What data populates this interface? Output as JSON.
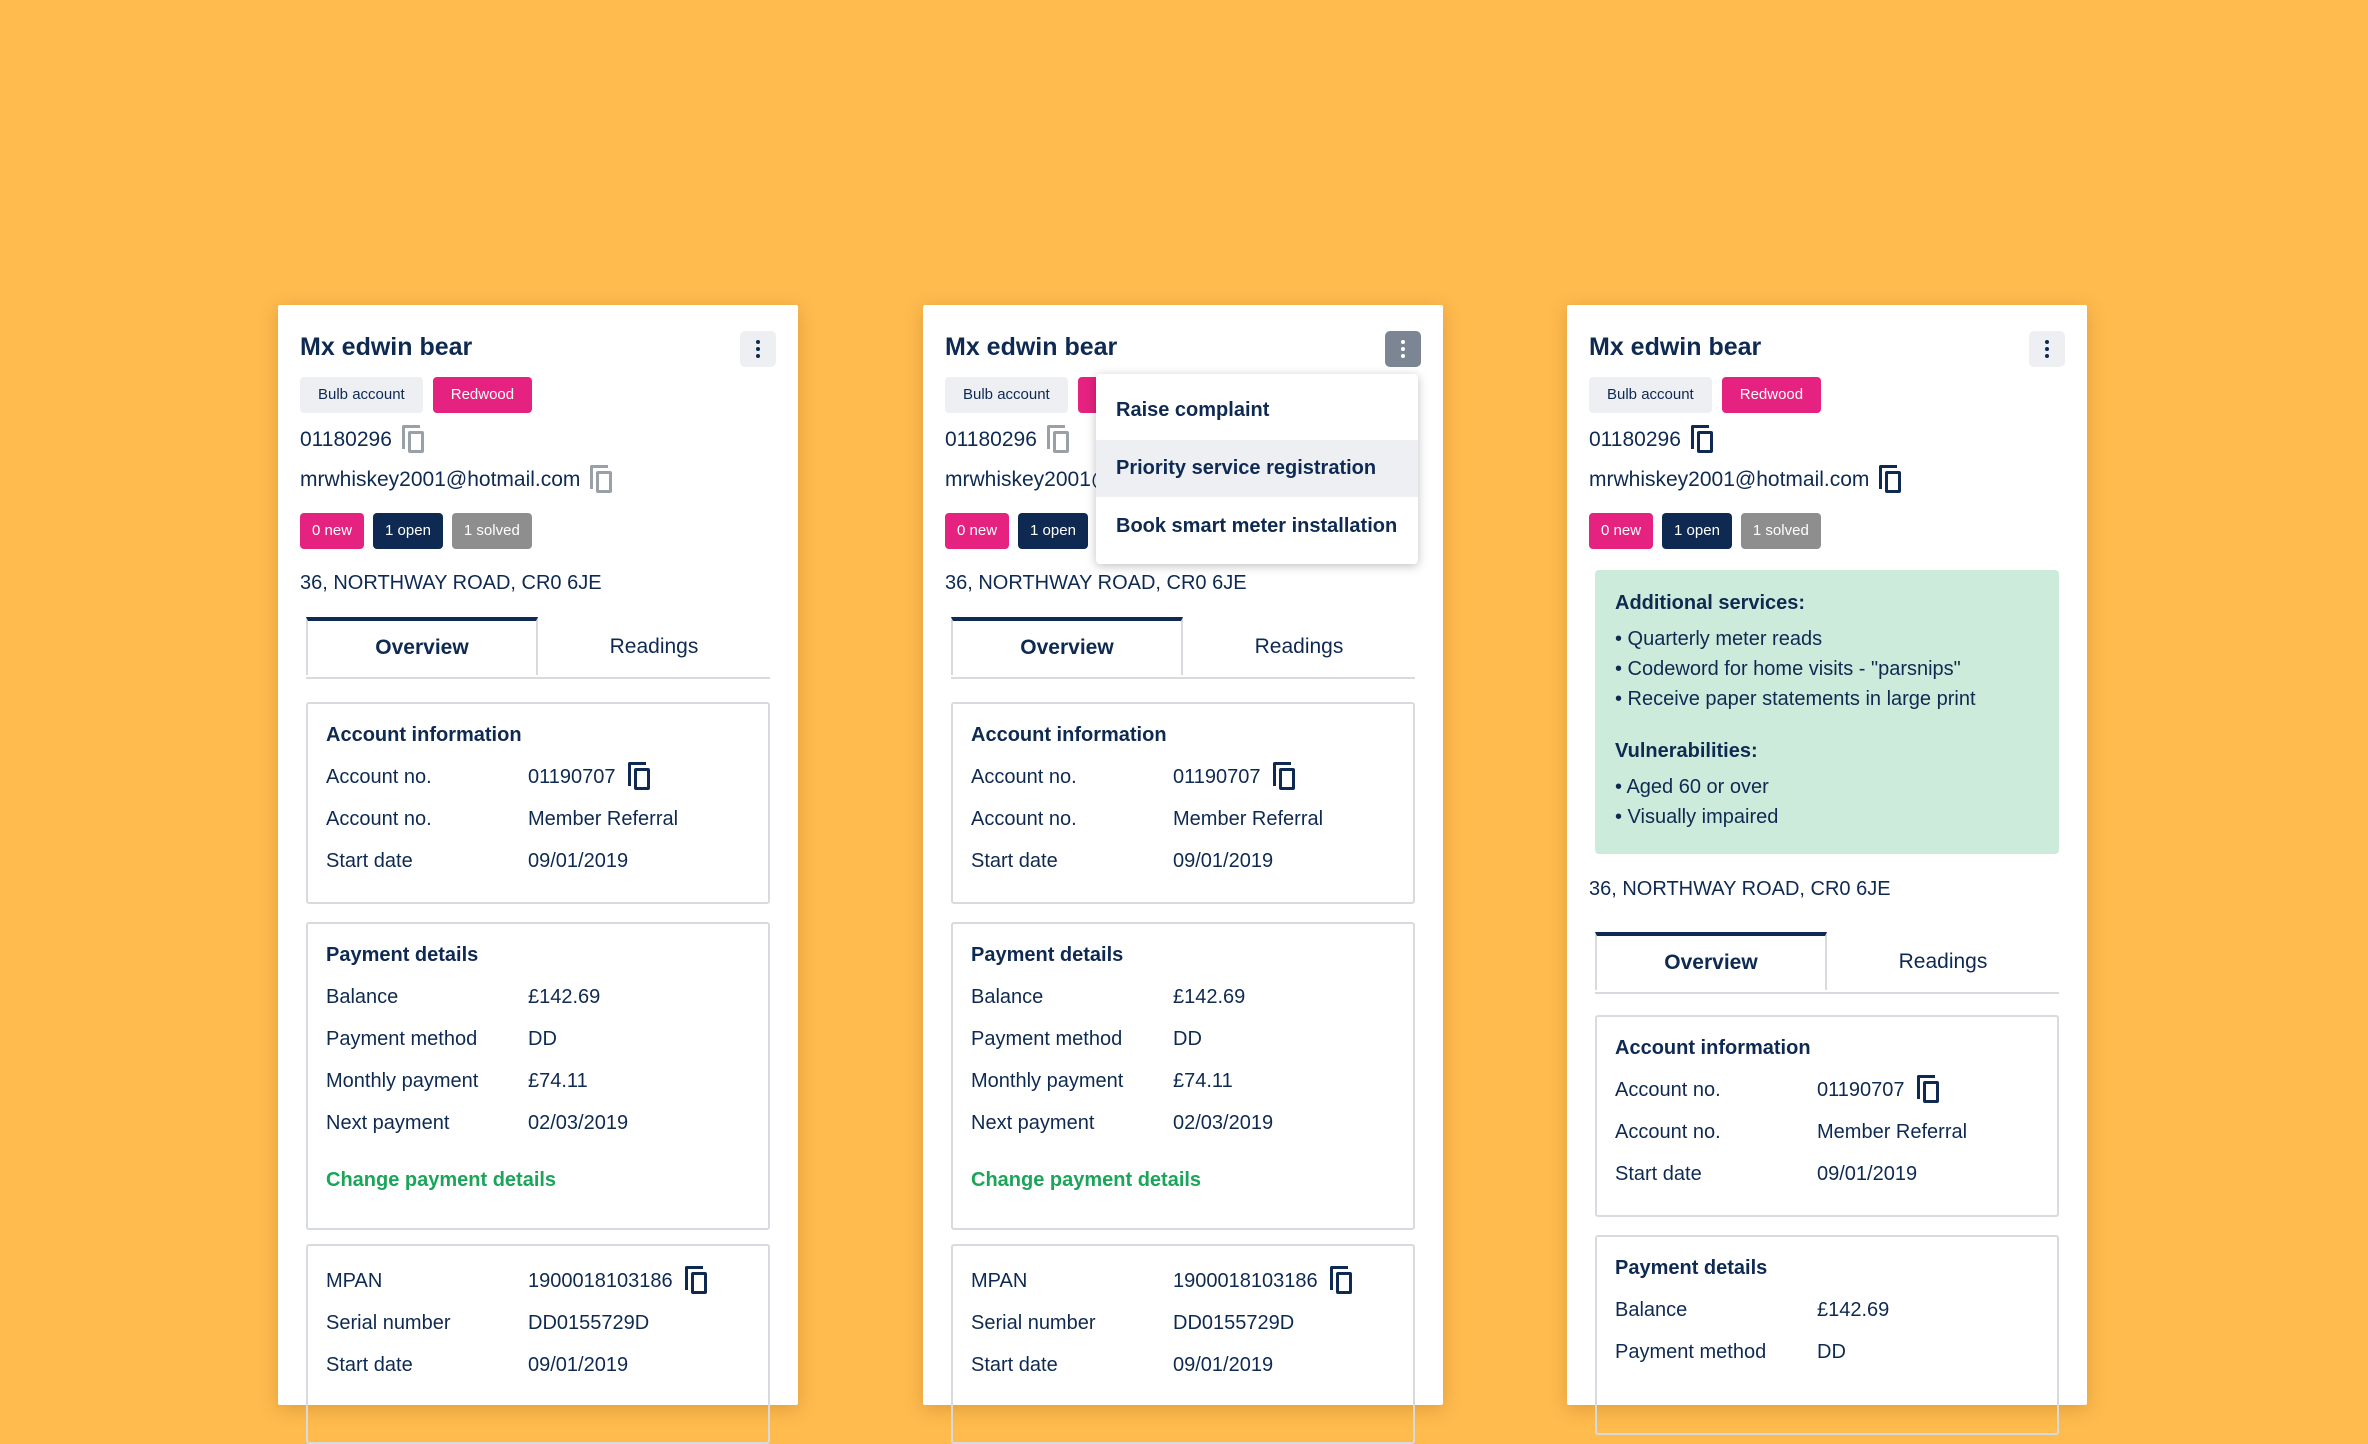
{
  "customer": {
    "name": "Mx edwin bear",
    "account_tag": "Bulb account",
    "tariff_tag": "Redwood",
    "phone": "01180296",
    "email": "mrwhiskey2001@hotmail.com",
    "counts": {
      "new": "0 new",
      "open": "1 open",
      "solved": "1 solved"
    },
    "address": "36, NORTHWAY ROAD, CR0 6JE"
  },
  "tabs": {
    "overview": "Overview",
    "readings": "Readings"
  },
  "account_info": {
    "title": "Account information",
    "rows": [
      {
        "label": "Account no.",
        "value": "01190707"
      },
      {
        "label": "Account no.",
        "value": "Member Referral"
      },
      {
        "label": "Start date",
        "value": "09/01/2019"
      }
    ]
  },
  "payment": {
    "title": "Payment details",
    "rows": [
      {
        "label": "Balance",
        "value": "£142.69"
      },
      {
        "label": "Payment method",
        "value": "DD"
      },
      {
        "label": "Monthly payment",
        "value": "£74.11"
      },
      {
        "label": "Next payment",
        "value": "02/03/2019"
      }
    ],
    "change_link": "Change payment details"
  },
  "meter": {
    "rows": [
      {
        "label": "MPAN",
        "value": "1900018103186"
      },
      {
        "label": "Serial number",
        "value": "DD0155729D"
      },
      {
        "label": "Start date",
        "value": "09/01/2019"
      }
    ]
  },
  "menu": {
    "items": [
      "Raise complaint",
      "Priority service registration",
      "Book smart meter installation"
    ]
  },
  "additional": {
    "services_title": "Additional services:",
    "services": [
      "• Quarterly meter reads",
      "• Codeword for home visits - \"parsnips\"",
      "• Receive paper statements in large print"
    ],
    "vuln_title": "Vulnerabilities:",
    "vulnerabilities": [
      "• Aged 60 or over",
      "• Visually impaired"
    ]
  },
  "colors": {
    "background": "#FFBB4E",
    "navy": "#0E2A52",
    "pink": "#E5227F",
    "green": "#1BA559",
    "mint": "#CDEBDA"
  }
}
